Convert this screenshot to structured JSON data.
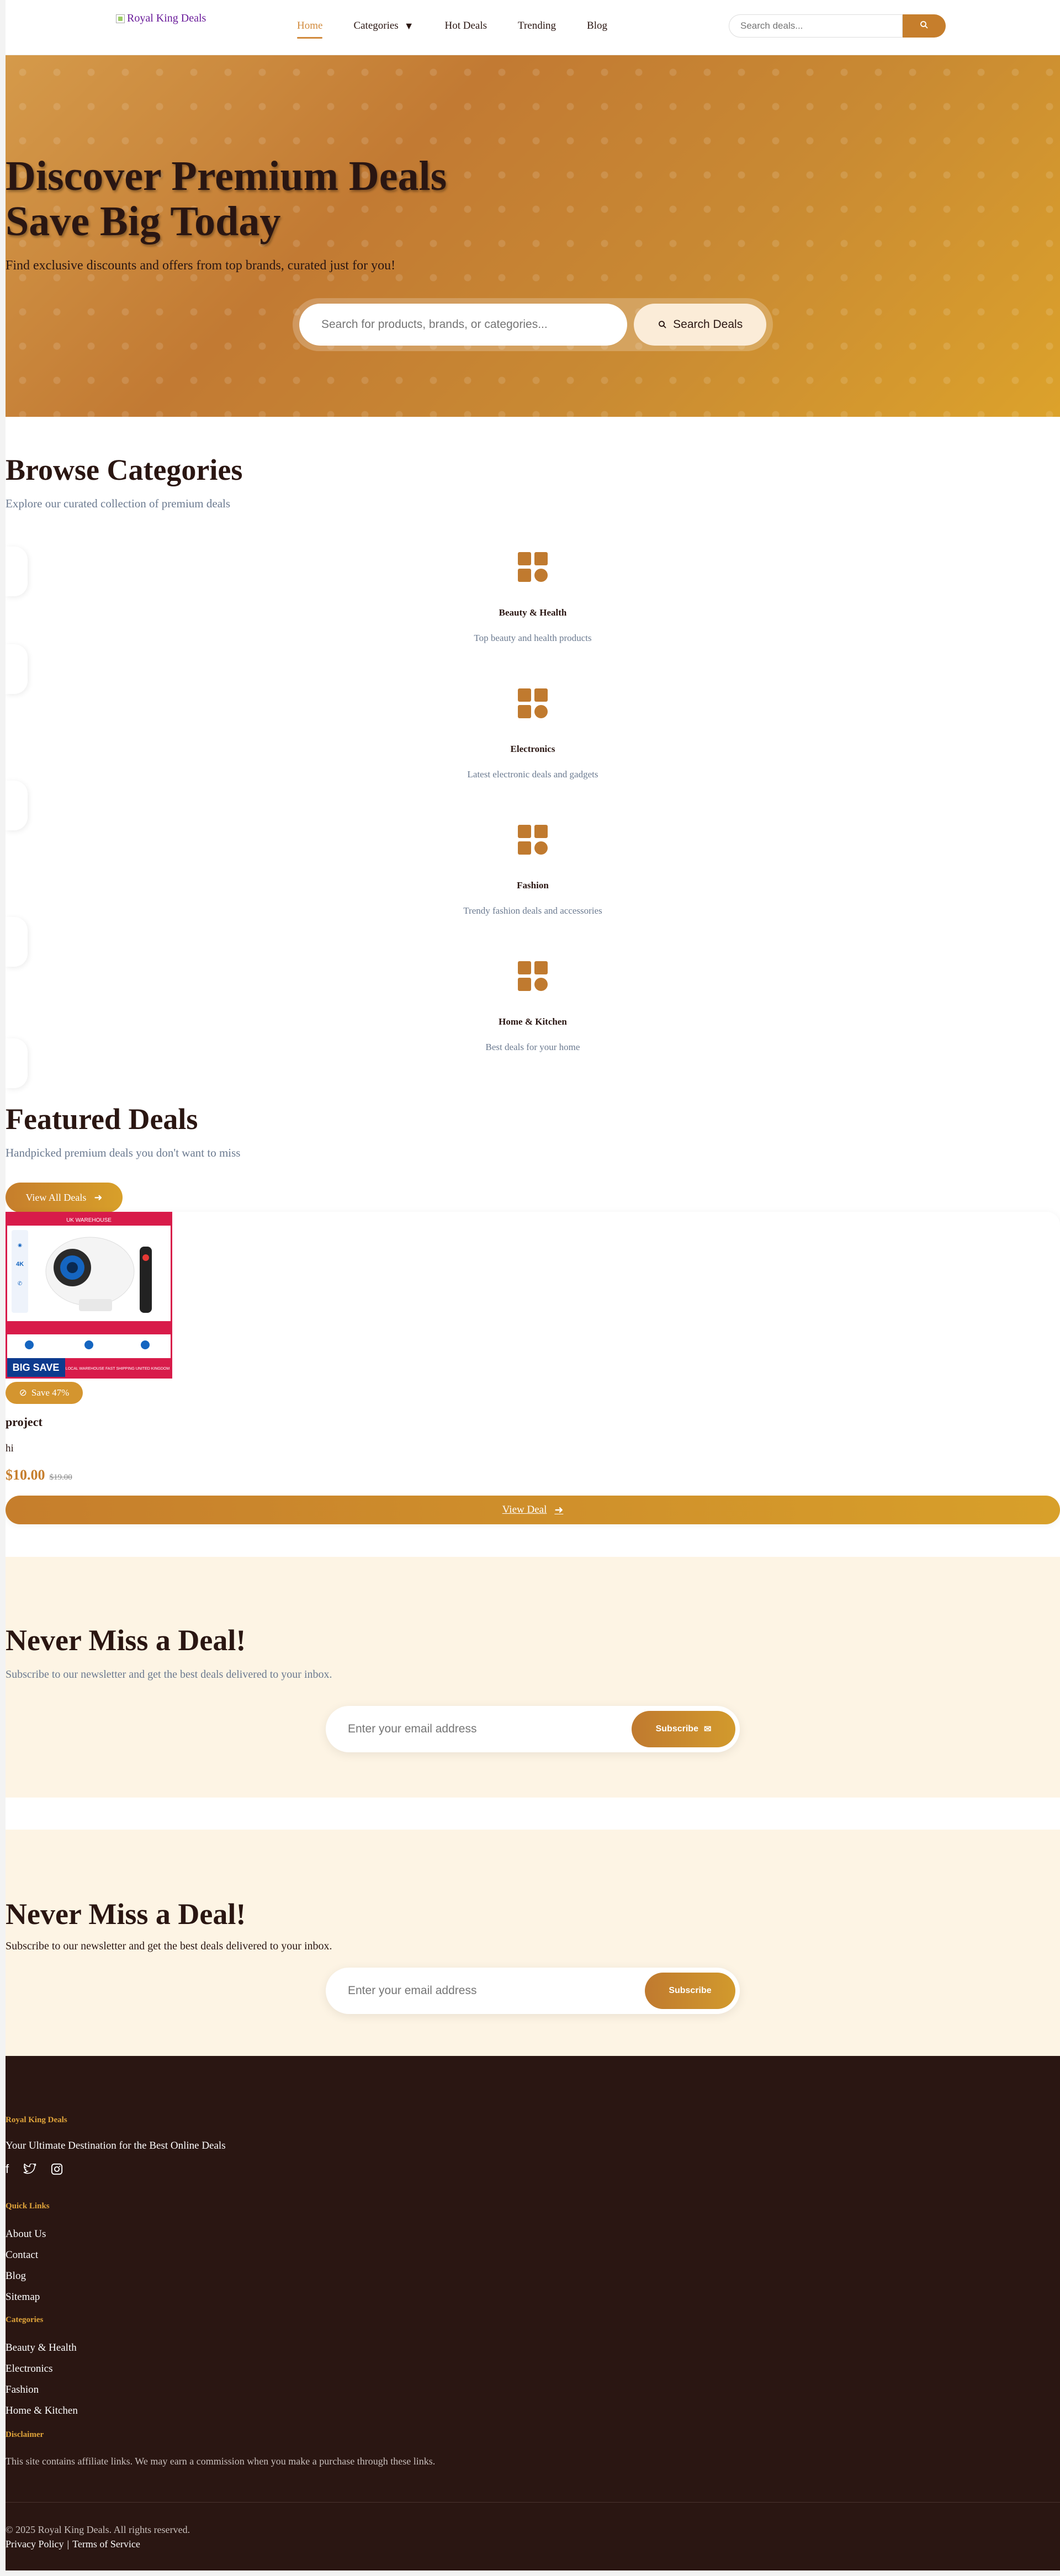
{
  "header": {
    "logo_alt": "Royal King Deals",
    "nav": [
      {
        "label": "Home"
      },
      {
        "label": "Categories"
      },
      {
        "label": "Hot Deals"
      },
      {
        "label": "Trending"
      },
      {
        "label": "Blog"
      }
    ],
    "search_placeholder": "Search deals..."
  },
  "hero": {
    "title_line1": "Discover Premium Deals",
    "title_line2": "Save Big Today",
    "subtitle": "Find exclusive discounts and offers from top brands, curated just for you!",
    "search_placeholder": "Search for products, brands, or categories...",
    "search_button": "Search Deals"
  },
  "categories": {
    "title": "Browse Categories",
    "subtitle": "Explore our curated collection of premium deals",
    "items": [
      {
        "name": "Beauty & Health",
        "desc": "Top beauty and health products"
      },
      {
        "name": "Electronics",
        "desc": "Latest electronic deals and gadgets"
      },
      {
        "name": "Fashion",
        "desc": "Trendy fashion deals and accessories"
      },
      {
        "name": "Home & Kitchen",
        "desc": "Best deals for your home"
      }
    ]
  },
  "featured": {
    "title": "Featured Deals",
    "subtitle": "Handpicked premium deals you don't want to miss",
    "view_all": "View All Deals",
    "deal": {
      "badge": "Save 47%",
      "title": "project",
      "desc": "hi",
      "price": "$10.00",
      "old_price": "$19.00",
      "cta": "View Deal",
      "image_text": {
        "big_save": "BIG SAVE",
        "banner": "LOCAL WAREHOUSE FAST SHIPPING UNITED KINGDOM",
        "top": "UK WAREHOUSE"
      }
    }
  },
  "newsletter1": {
    "title": "Never Miss a Deal!",
    "subtitle": "Subscribe to our newsletter and get the best deals delivered to your inbox.",
    "placeholder": "Enter your email address",
    "button": "Subscribe"
  },
  "newsletter2": {
    "title": "Never Miss a Deal!",
    "subtitle": "Subscribe to our newsletter and get the best deals delivered to your inbox.",
    "placeholder": "Enter your email address",
    "button": "Subscribe"
  },
  "footer": {
    "brand": "Royal King Deals",
    "tagline": "Your Ultimate Destination for the Best Online Deals",
    "quick_links_title": "Quick Links",
    "quick_links": [
      "About Us",
      "Contact",
      "Blog",
      "Sitemap"
    ],
    "categories_title": "Categories",
    "categories": [
      "Beauty & Health",
      "Electronics",
      "Fashion",
      "Home & Kitchen"
    ],
    "disclaimer_title": "Disclaimer",
    "disclaimer": "This site contains affiliate links. We may earn a commission when you make a purchase through these links.",
    "copyright": "© 2025 Royal King Deals. All rights reserved.",
    "privacy": "Privacy Policy",
    "separator": "|",
    "terms": "Terms of Service"
  },
  "colors": {
    "accent": "#c67e2c",
    "gold": "#dca22b",
    "footer_bg": "#2a1612",
    "cream": "#fdf4e4"
  }
}
